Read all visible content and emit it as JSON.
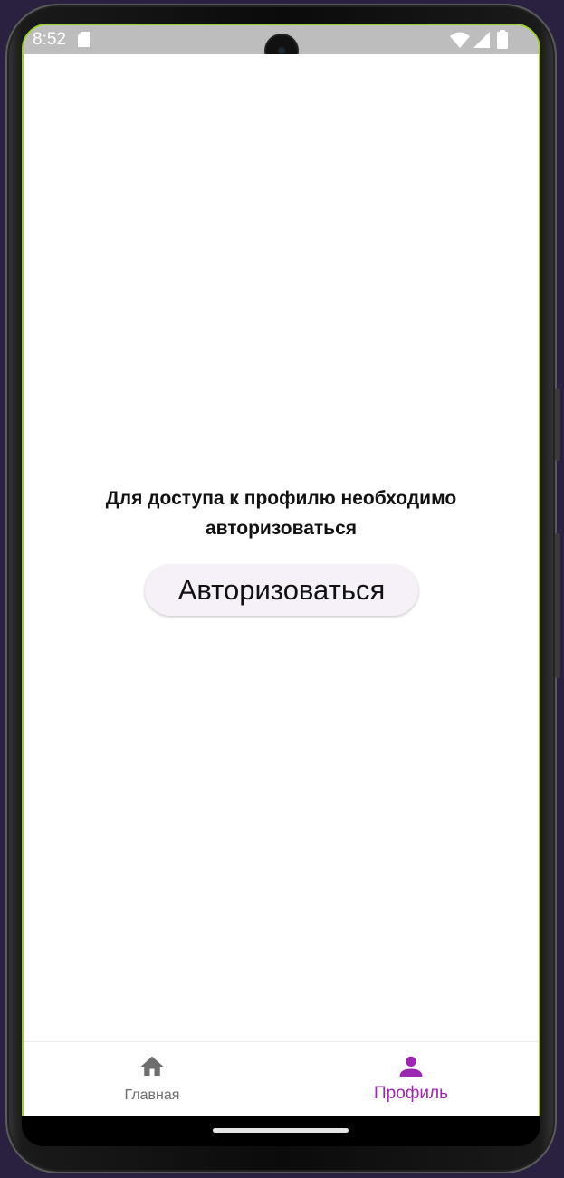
{
  "status_bar": {
    "time": "8:52",
    "icons": [
      "sd-card-icon",
      "wifi-icon",
      "signal-icon",
      "battery-icon"
    ]
  },
  "content": {
    "message": "Для доступа к профилю необходимо авторизоваться",
    "auth_button_label": "Авторизоваться"
  },
  "bottom_nav": {
    "items": [
      {
        "label": "Главная",
        "icon": "home-icon",
        "active": false
      },
      {
        "label": "Профиль",
        "icon": "person-icon",
        "active": true
      }
    ]
  },
  "colors": {
    "accent": "#9c27b0",
    "inactive": "#6e6e6e",
    "status_bar_bg": "#bdbdbd",
    "button_bg": "#f6f0f8",
    "screen_border": "#9acd32"
  }
}
